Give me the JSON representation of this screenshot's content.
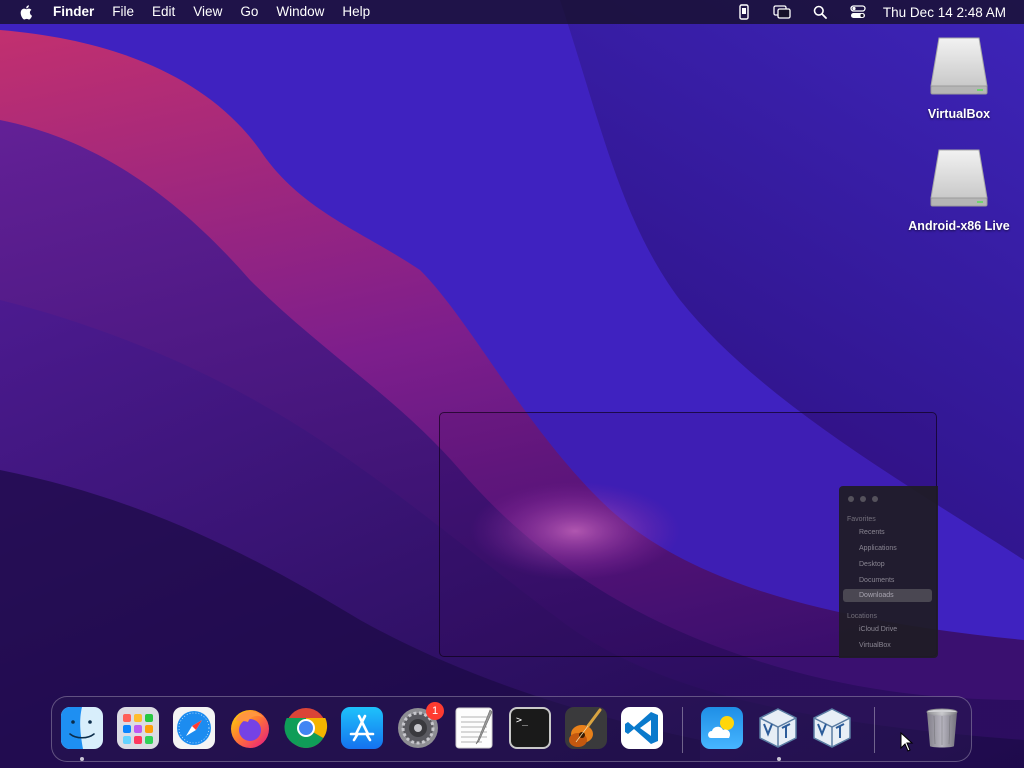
{
  "menubar": {
    "app_name": "Finder",
    "menus": [
      "File",
      "Edit",
      "View",
      "Go",
      "Window",
      "Help"
    ],
    "clock": "Thu Dec 14  2:48 AM",
    "status_icons": [
      "phone-mirroring-icon",
      "screen-mirroring-icon",
      "spotlight-icon",
      "control-center-icon"
    ]
  },
  "desktop": {
    "drives": [
      {
        "label": "VirtualBox",
        "icon": "drive-icon"
      },
      {
        "label": "Android-x86 Live",
        "icon": "drive-icon"
      }
    ]
  },
  "ghost_window": {
    "sidebar": {
      "favorites_label": "Favorites",
      "favorites": [
        "Recents",
        "Applications",
        "Desktop",
        "Documents",
        "Downloads"
      ],
      "selected": "Downloads",
      "locations_label": "Locations",
      "locations": [
        "iCloud Drive",
        "VirtualBox"
      ]
    }
  },
  "dock": {
    "apps": [
      {
        "name": "Finder",
        "icon": "finder-icon",
        "running": true
      },
      {
        "name": "Launchpad",
        "icon": "launchpad-icon",
        "running": false
      },
      {
        "name": "Safari",
        "icon": "safari-icon",
        "running": false
      },
      {
        "name": "Firefox",
        "icon": "firefox-icon",
        "running": false
      },
      {
        "name": "Chrome",
        "icon": "chrome-icon",
        "running": false
      },
      {
        "name": "App Store",
        "icon": "app-store-icon",
        "running": false
      },
      {
        "name": "System Settings",
        "icon": "settings-icon",
        "running": false,
        "badge": "1"
      },
      {
        "name": "TextEdit",
        "icon": "textedit-icon",
        "running": false
      },
      {
        "name": "Terminal",
        "icon": "terminal-icon",
        "running": false
      },
      {
        "name": "GarageBand",
        "icon": "garageband-icon",
        "running": false
      },
      {
        "name": "VS Code",
        "icon": "vscode-icon",
        "running": false
      },
      {
        "name": "Weather",
        "icon": "weather-icon",
        "running": false
      },
      {
        "name": "VirtualBox",
        "icon": "virtualbox-icon",
        "running": true
      },
      {
        "name": "VirtualBox VM",
        "icon": "virtualbox-icon",
        "running": false
      },
      {
        "name": "Trash",
        "icon": "trash-icon",
        "running": false
      }
    ],
    "terminal_prompt": ">_"
  },
  "colors": {
    "accent": "#0a84ff",
    "badge": "#ff3b30",
    "menubar": "#161028"
  }
}
